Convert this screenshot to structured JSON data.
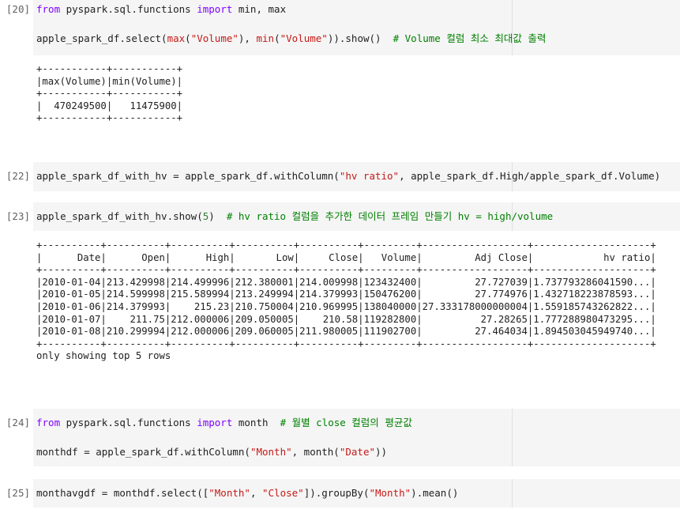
{
  "cells": [
    {
      "prompt": "[20]",
      "code": [
        [
          {
            "t": "from",
            "c": "kw"
          },
          {
            "t": " pyspark.sql.functions ",
            "c": "plain"
          },
          {
            "t": "import",
            "c": "kw"
          },
          {
            "t": " min, max",
            "c": "plain"
          }
        ],
        [],
        [
          {
            "t": "apple_spark_df.select(",
            "c": "plain"
          },
          {
            "t": "max",
            "c": "fn"
          },
          {
            "t": "(",
            "c": "plain"
          },
          {
            "t": "\"Volume\"",
            "c": "str"
          },
          {
            "t": "), ",
            "c": "plain"
          },
          {
            "t": "min",
            "c": "fn"
          },
          {
            "t": "(",
            "c": "plain"
          },
          {
            "t": "\"Volume\"",
            "c": "str"
          },
          {
            "t": ")).show()  ",
            "c": "plain"
          },
          {
            "t": "# Volume 컬럼 최소 최대값 출력",
            "c": "cm"
          }
        ]
      ],
      "output": "+-----------+-----------+\n|max(Volume)|min(Volume)|\n+-----------+-----------+\n|  470249500|   11475900|\n+-----------+-----------+"
    },
    {
      "prompt": "[22]",
      "code": [
        [
          {
            "t": "apple_spark_df_with_hv = apple_spark_df.withColumn(",
            "c": "plain"
          },
          {
            "t": "\"hv ratio\"",
            "c": "str"
          },
          {
            "t": ", apple_spark_df.High/apple_spark_df.Volume)",
            "c": "plain"
          }
        ]
      ],
      "output": ""
    },
    {
      "prompt": "[23]",
      "code": [
        [
          {
            "t": "apple_spark_df_with_hv.show(",
            "c": "plain"
          },
          {
            "t": "5",
            "c": "num"
          },
          {
            "t": ")  ",
            "c": "plain"
          },
          {
            "t": "# hv ratio 컬럼을 추가한 데이터 프레임 만들기 hv = high/volume",
            "c": "cm"
          }
        ]
      ],
      "output": "+----------+----------+----------+----------+----------+---------+------------------+--------------------+\n|      Date|      Open|      High|       Low|     Close|   Volume|         Adj Close|            hv ratio|\n+----------+----------+----------+----------+----------+---------+------------------+--------------------+\n|2010-01-04|213.429998|214.499996|212.380001|214.009998|123432400|         27.727039|1.737793286041590...|\n|2010-01-05|214.599998|215.589994|213.249994|214.379993|150476200|         27.774976|1.432718223878593...|\n|2010-01-06|214.379993|    215.23|210.750004|210.969995|138040000|27.333178000000004|1.559185743262822...|\n|2010-01-07|    211.75|212.000006|209.050005|    210.58|119282800|          27.28265|1.777288980473295...|\n|2010-01-08|210.299994|212.000006|209.060005|211.980005|111902700|         27.464034|1.894503045949740...|\n+----------+----------+----------+----------+----------+---------+------------------+--------------------+\nonly showing top 5 rows"
    },
    {
      "prompt": "[24]",
      "code": [
        [
          {
            "t": "from",
            "c": "kw"
          },
          {
            "t": " pyspark.sql.functions ",
            "c": "plain"
          },
          {
            "t": "import",
            "c": "kw"
          },
          {
            "t": " month  ",
            "c": "plain"
          },
          {
            "t": "# 월별 close 컬럼의 평균값",
            "c": "cm"
          }
        ],
        [],
        [
          {
            "t": "monthdf = apple_spark_df.withColumn(",
            "c": "plain"
          },
          {
            "t": "\"Month\"",
            "c": "str"
          },
          {
            "t": ", month(",
            "c": "plain"
          },
          {
            "t": "\"Date\"",
            "c": "str"
          },
          {
            "t": "))",
            "c": "plain"
          }
        ]
      ],
      "output": ""
    },
    {
      "prompt": "[25]",
      "code": [
        [
          {
            "t": "monthavgdf = monthdf.select([",
            "c": "plain"
          },
          {
            "t": "\"Month\"",
            "c": "str"
          },
          {
            "t": ", ",
            "c": "plain"
          },
          {
            "t": "\"Close\"",
            "c": "str"
          },
          {
            "t": "]).groupBy(",
            "c": "plain"
          },
          {
            "t": "\"Month\"",
            "c": "str"
          },
          {
            "t": ").mean()",
            "c": "plain"
          }
        ]
      ],
      "output": ""
    }
  ]
}
